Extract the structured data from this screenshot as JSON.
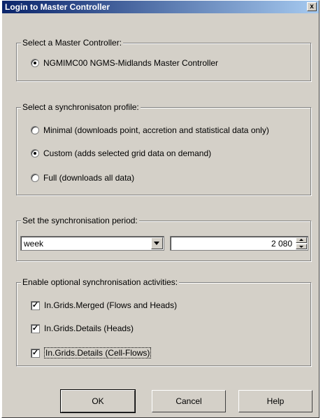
{
  "window": {
    "title": "Login to Master Controller",
    "close_label": "x"
  },
  "master_group": {
    "legend": "Select a Master Controller:",
    "option": "NGMIMC00  NGMS-Midlands Master Controller"
  },
  "profile_group": {
    "legend": "Select a synchronisaton profile:",
    "options": [
      {
        "label": "Minimal (downloads point, accretion and statistical data only)",
        "selected": false
      },
      {
        "label": "Custom (adds selected grid data on demand)",
        "selected": true
      },
      {
        "label": "Full (downloads all data)",
        "selected": false
      }
    ]
  },
  "period_group": {
    "legend": "Set the synchronisation period:",
    "unit_value": "week",
    "count_value": "2 080"
  },
  "activities_group": {
    "legend": "Enable optional synchronisation activities:",
    "items": [
      {
        "label": "In.Grids.Merged (Flows and Heads)",
        "checked": true
      },
      {
        "label": "In.Grids.Details (Heads)",
        "checked": true
      },
      {
        "label": "In.Grids.Details (Cell-Flows)",
        "checked": true
      }
    ]
  },
  "buttons": {
    "ok": "OK",
    "cancel": "Cancel",
    "help": "Help"
  }
}
